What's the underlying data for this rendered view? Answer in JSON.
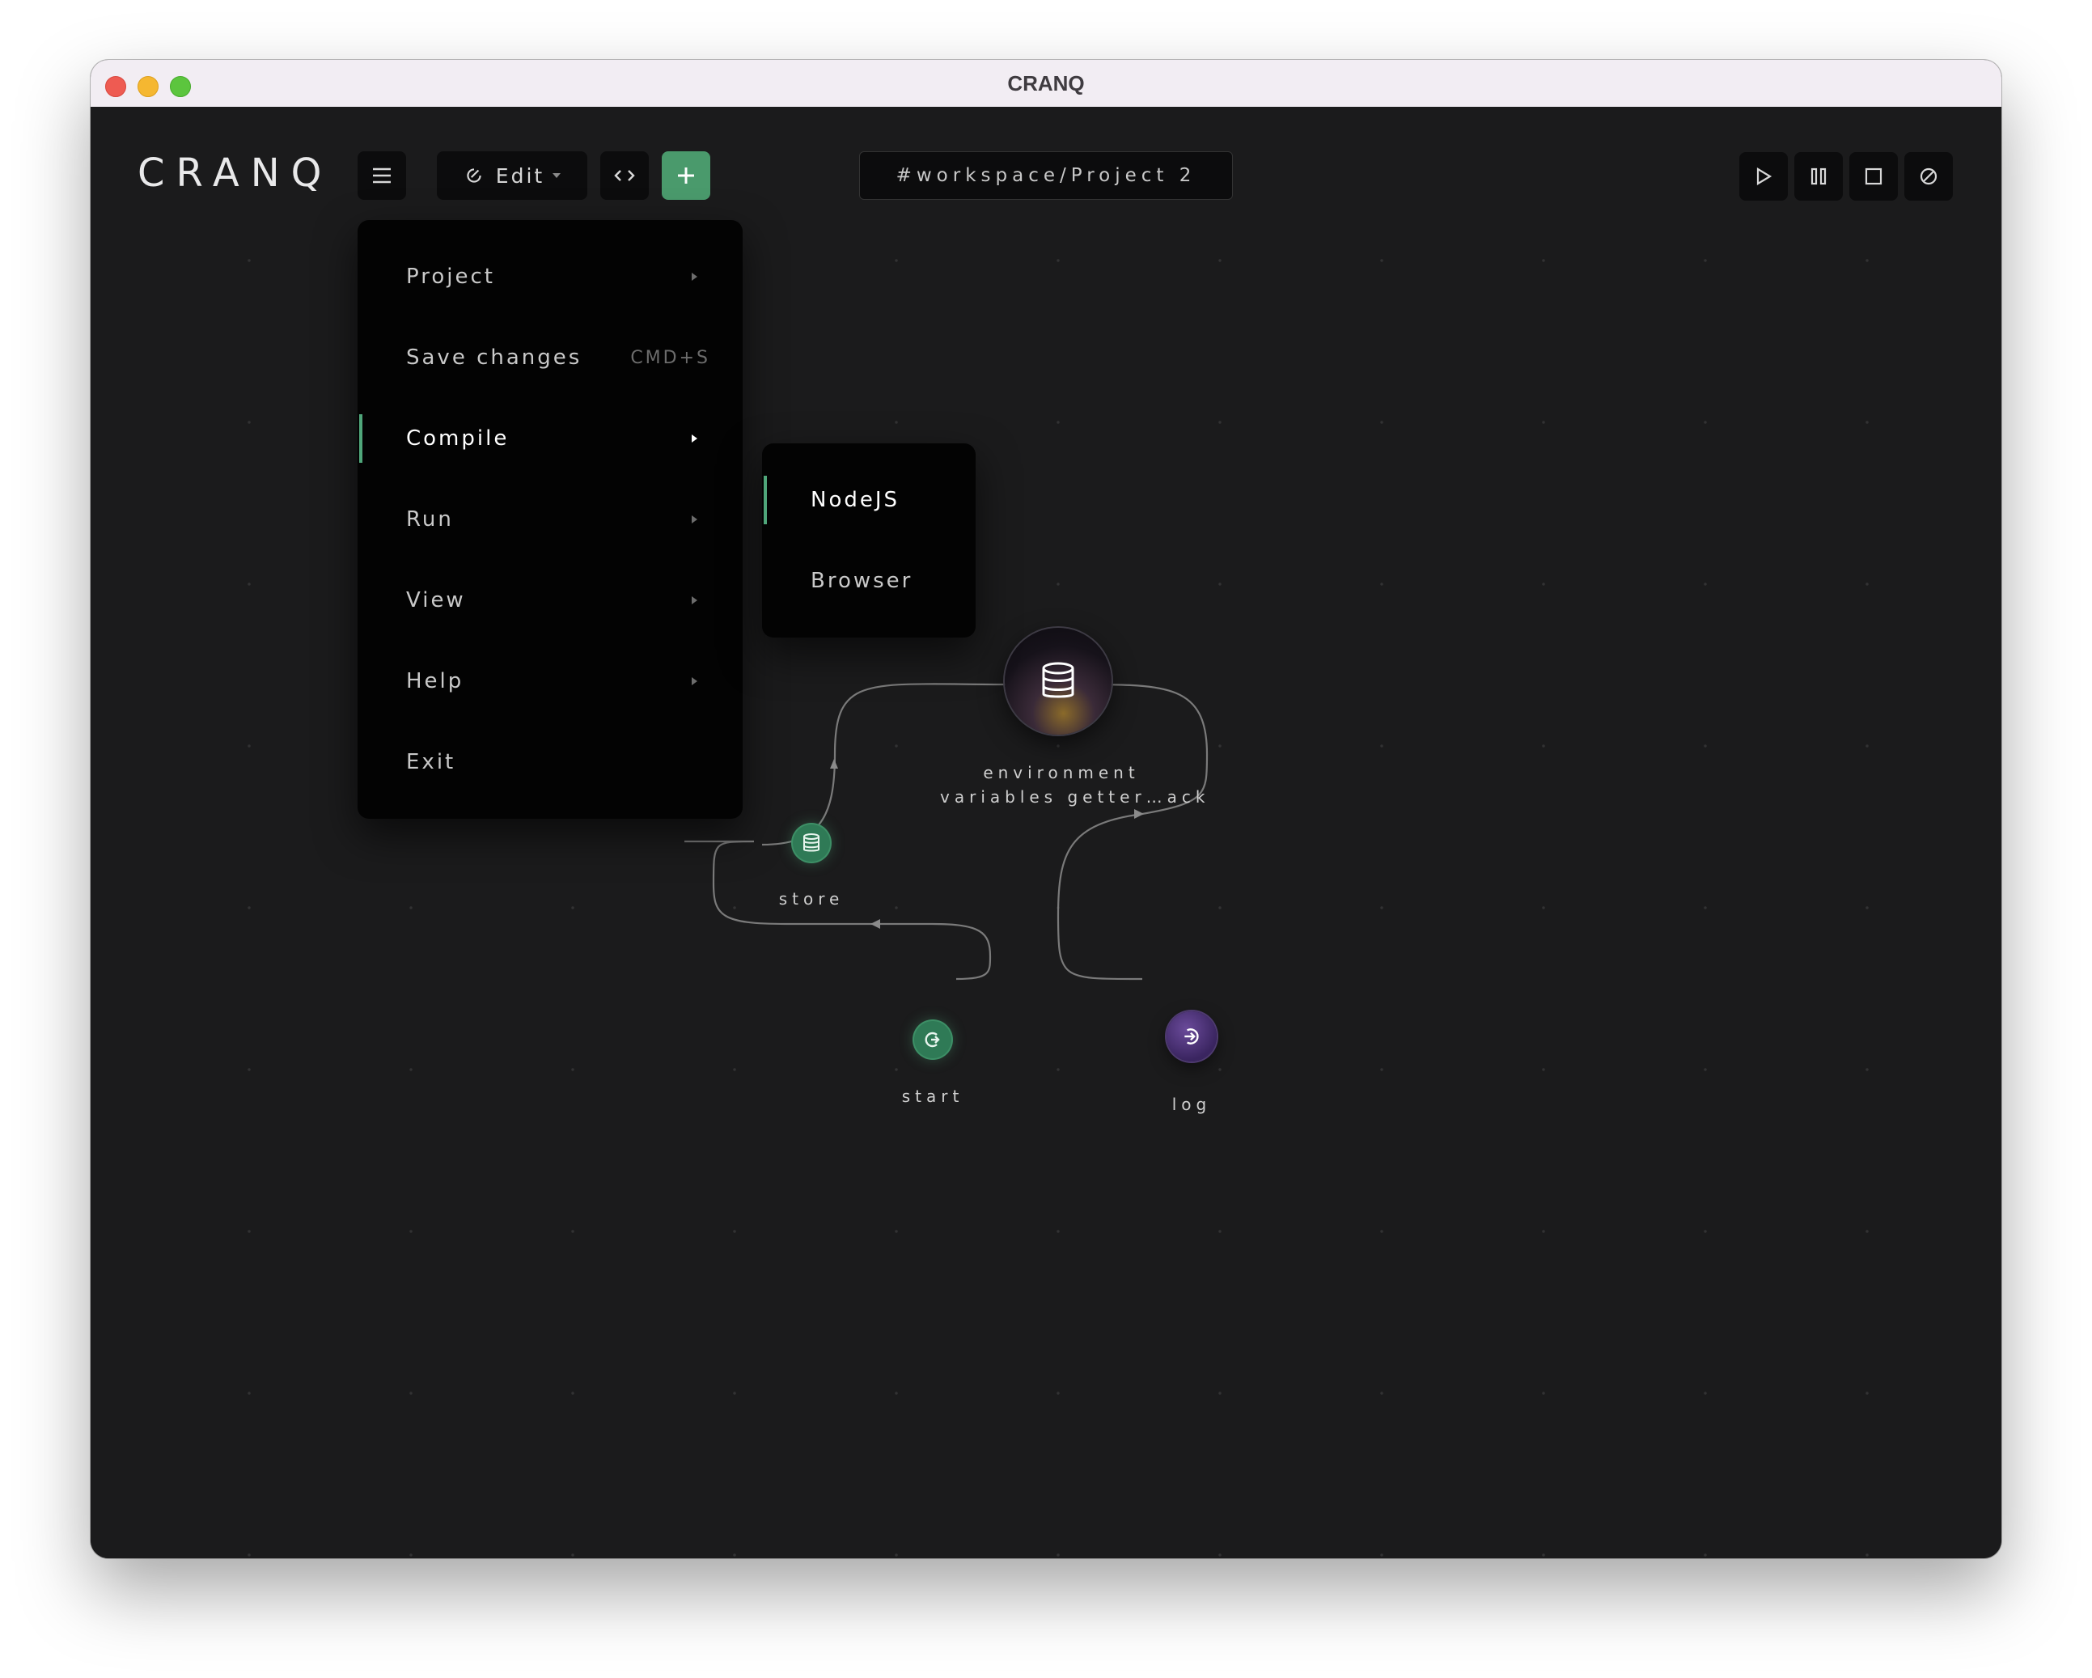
{
  "window": {
    "title": "CRANQ"
  },
  "toolbar": {
    "logo": "CRANQ",
    "menu_icon": "hamburger-icon",
    "edit_label": "Edit",
    "code_icon": "code-brackets-icon",
    "add_icon": "plus-icon",
    "workspace_path": "#workspace/Project 2",
    "run_controls": [
      "play-icon",
      "pause-icon",
      "stop-icon",
      "cancel-icon"
    ]
  },
  "menu": {
    "items": [
      {
        "label": "Project",
        "has_submenu": true
      },
      {
        "label": "Save changes",
        "shortcut": "CMD+S"
      },
      {
        "label": "Compile",
        "has_submenu": true,
        "active": true
      },
      {
        "label": "Run",
        "has_submenu": true
      },
      {
        "label": "View",
        "has_submenu": true
      },
      {
        "label": "Help",
        "has_submenu": true
      },
      {
        "label": "Exit"
      }
    ]
  },
  "submenu": {
    "items": [
      {
        "label": "NodeJS",
        "active": true
      },
      {
        "label": "Browser"
      }
    ]
  },
  "graph": {
    "nodes": {
      "env": {
        "label_line1": "environment",
        "label_line2": "variables getter…ack",
        "icon": "database-icon"
      },
      "store": {
        "label": "store",
        "icon": "database-icon"
      },
      "start": {
        "label": "start",
        "icon": "start-icon"
      },
      "log": {
        "label": "log",
        "icon": "log-input-icon"
      }
    }
  },
  "colors": {
    "accent_green": "#4fa67a",
    "canvas_bg": "#1b1b1c",
    "menu_bg": "#030303",
    "log_purple": "#4a3370"
  }
}
